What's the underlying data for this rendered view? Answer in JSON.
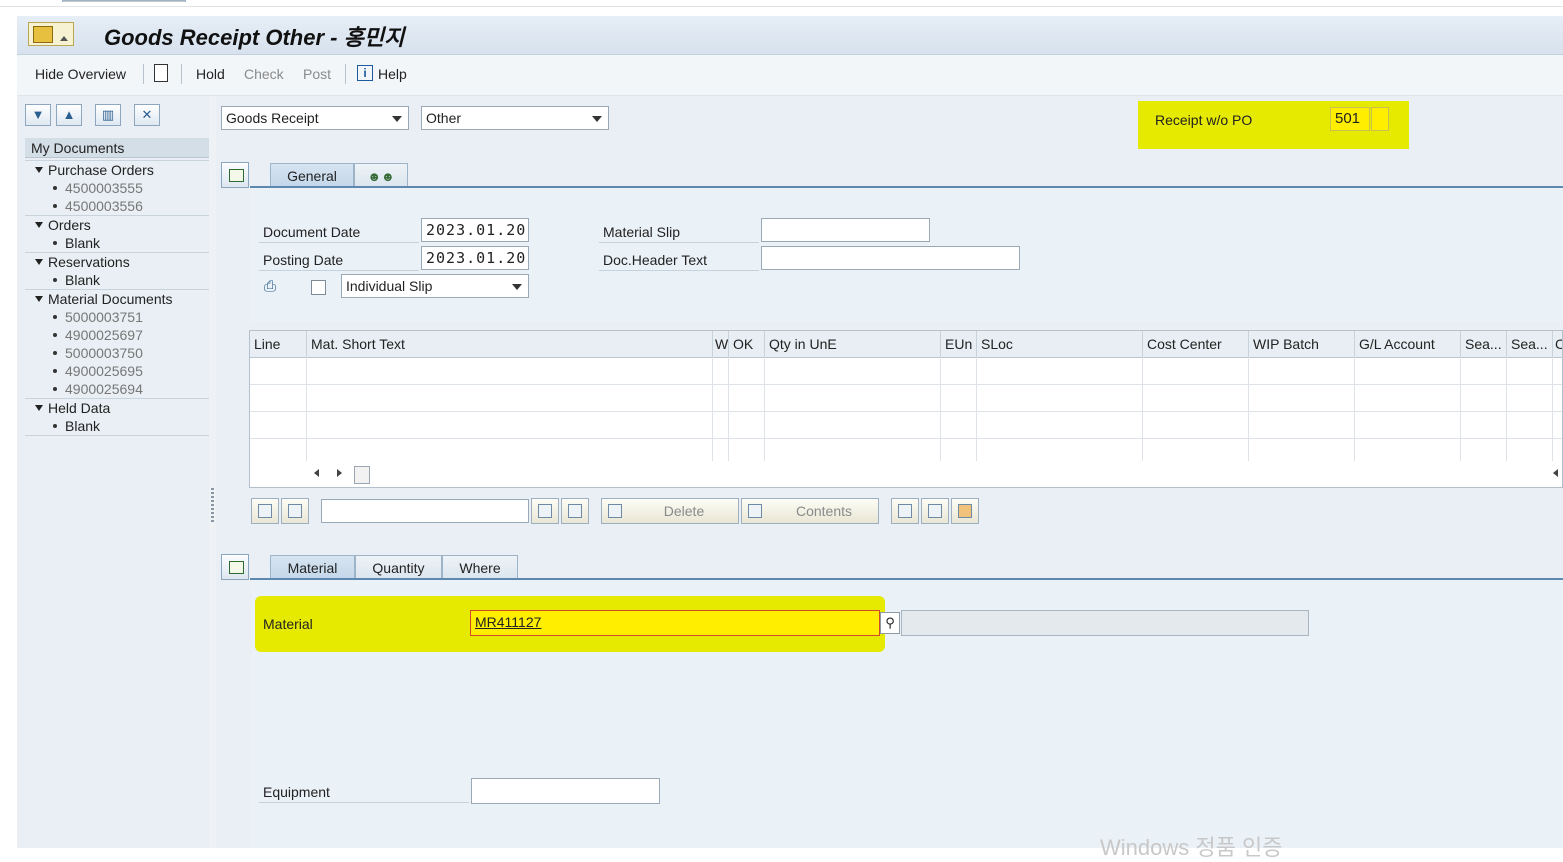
{
  "window": {
    "title": "Goods Receipt Other - 홍민지"
  },
  "toolbar": {
    "hide_overview": "Hide Overview",
    "hold": "Hold",
    "check": "Check",
    "post": "Post",
    "help": "Help"
  },
  "left_panel": {
    "header": "My Documents",
    "tree": [
      {
        "label": "Purchase Orders",
        "items": [
          "4500003555",
          "4500003556"
        ]
      },
      {
        "label": "Orders",
        "items": [
          "Blank"
        ]
      },
      {
        "label": "Reservations",
        "items": [
          "Blank"
        ]
      },
      {
        "label": "Material Documents",
        "items": [
          "5000003751",
          "4900025697",
          "5000003750",
          "4900025695",
          "4900025694"
        ]
      },
      {
        "label": "Held Data",
        "items": [
          "Blank"
        ]
      }
    ]
  },
  "header": {
    "transaction_select": "Goods Receipt",
    "reference_select": "Other",
    "movement_label": "Receipt w/o PO",
    "movement_type": "501"
  },
  "general_tabs": [
    {
      "label": "General"
    },
    {
      "label": "",
      "icon": "people-icon"
    }
  ],
  "general": {
    "document_date_label": "Document Date",
    "document_date": "2023.01.20",
    "posting_date_label": "Posting Date",
    "posting_date": "2023.01.20",
    "material_slip_label": "Material Slip",
    "material_slip": "",
    "doc_header_text_label": "Doc.Header Text",
    "doc_header_text": "",
    "print_select": "Individual Slip"
  },
  "item_table": {
    "columns": [
      "Line",
      "Mat. Short Text",
      "W",
      "OK",
      "Qty in UnE",
      "EUn",
      "SLoc",
      "Cost Center",
      "WIP Batch",
      "G/L Account",
      "Sea...",
      "Sea...",
      "C"
    ],
    "rows": []
  },
  "item_toolbar": {
    "delete": "Delete",
    "contents": "Contents",
    "search_value": ""
  },
  "detail_tabs": [
    {
      "label": "Material"
    },
    {
      "label": "Quantity"
    },
    {
      "label": "Where"
    }
  ],
  "detail": {
    "material_label": "Material",
    "material_value": "MR411127",
    "material_description": "",
    "equipment_label": "Equipment",
    "equipment_value": ""
  },
  "watermark": "Windows 정품 인증",
  "colors": {
    "highlight": "#e6ea00",
    "tab_accent": "#5e88b0",
    "panel_bg": "#e9eff4"
  }
}
